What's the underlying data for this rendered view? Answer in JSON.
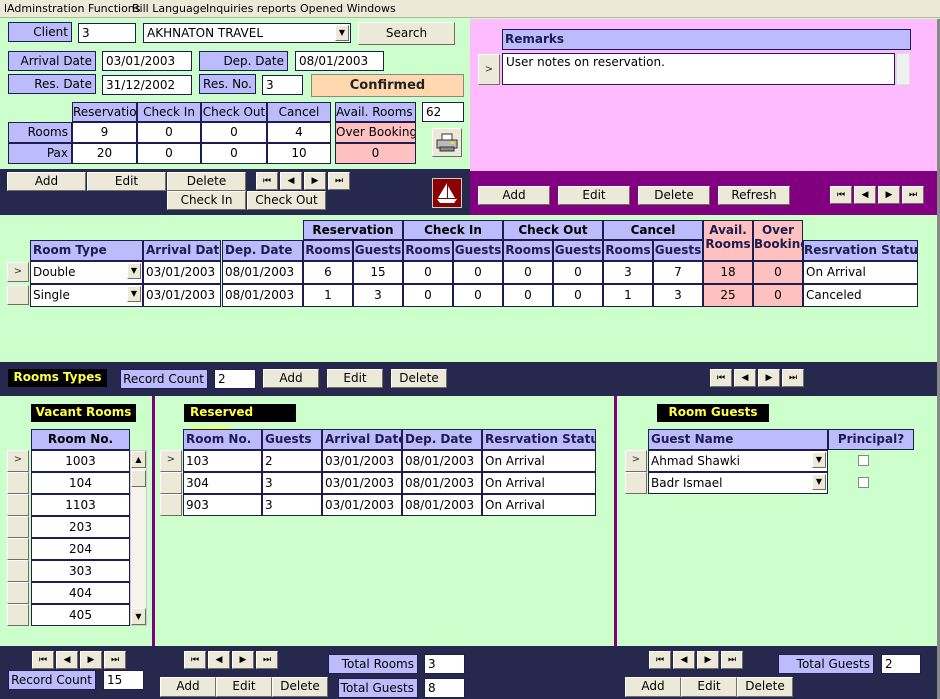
{
  "menu": [
    "lAdminstration Functions",
    "Bill Language",
    "Inquiries  reports",
    "Opened Windows"
  ],
  "header": {
    "client_label": "Client",
    "client_id": "3",
    "client_name": "AKHNATON TRAVEL",
    "search_label": "Search",
    "arrival_label": "Arrival Date",
    "arrival_value": "03/01/2003",
    "dep_label": "Dep. Date",
    "dep_value": "08/01/2003",
    "resdate_label": "Res. Date",
    "resdate_value": "31/12/2002",
    "resno_label": "Res. No.",
    "resno_value": "3",
    "status": "Confirmed"
  },
  "summary": {
    "columns": [
      "Reservation",
      "Check In",
      "Check Out",
      "Cancel"
    ],
    "rows": [
      {
        "label": "Rooms",
        "values": [
          "9",
          "0",
          "0",
          "4"
        ]
      },
      {
        "label": "Pax",
        "values": [
          "20",
          "0",
          "0",
          "10"
        ]
      }
    ],
    "avail_label": "Avail. Rooms",
    "avail_value": "62",
    "overbooking_label": "Over Booking",
    "overbooking_value": "0"
  },
  "main_toolbar": {
    "add": "Add",
    "edit": "Edit",
    "delete": "Delete",
    "checkin": "Check In",
    "checkout": "Check Out"
  },
  "remarks": {
    "title": "Remarks",
    "text": "User notes on reservation.",
    "add": "Add",
    "edit": "Edit",
    "delete": "Delete",
    "refresh": "Refresh"
  },
  "room_types": {
    "group_headers": [
      "Reservation",
      "Check In",
      "Check Out",
      "Cancel"
    ],
    "headers": [
      "Room Type",
      "Arrival Date",
      "Dep. Date",
      "Rooms",
      "Guests",
      "Rooms",
      "Guests",
      "Rooms",
      "Guests",
      "Rooms",
      "Guests",
      "Avail. Rooms",
      "Over Booking",
      "Resrvation Status"
    ],
    "rows": [
      [
        "Double",
        "03/01/2003",
        "08/01/2003",
        "6",
        "15",
        "0",
        "0",
        "0",
        "0",
        "3",
        "7",
        "18",
        "0",
        "On Arrival"
      ],
      [
        "Single",
        "03/01/2003",
        "08/01/2003",
        "1",
        "3",
        "0",
        "0",
        "0",
        "0",
        "1",
        "3",
        "25",
        "0",
        "Canceled"
      ]
    ]
  },
  "room_types_bar": {
    "title": "Rooms Types",
    "record_count_label": "Record Count",
    "record_count": "2",
    "add": "Add",
    "edit": "Edit",
    "delete": "Delete"
  },
  "vacant": {
    "title": "Vacant Rooms",
    "header": "Room No.",
    "rows": [
      "1003",
      "104",
      "1103",
      "203",
      "204",
      "303",
      "404",
      "405"
    ],
    "record_count_label": "Record Count",
    "record_count": "15"
  },
  "reserved": {
    "title": "Reserved rooms",
    "headers": [
      "Room No.",
      "Guests",
      "Arrival Date",
      "Dep. Date",
      "Resrvation Status"
    ],
    "rows": [
      [
        "103",
        "2",
        "03/01/2003",
        "08/01/2003",
        "On Arrival"
      ],
      [
        "304",
        "3",
        "03/01/2003",
        "08/01/2003",
        "On Arrival"
      ],
      [
        "903",
        "3",
        "03/01/2003",
        "08/01/2003",
        "On Arrival"
      ]
    ],
    "total_rooms_label": "Total Rooms",
    "total_rooms": "3",
    "total_guests_label": "Total Guests",
    "total_guests": "8",
    "add": "Add",
    "edit": "Edit",
    "delete": "Delete"
  },
  "guests": {
    "title": "Room Guests",
    "headers": [
      "Guest Name",
      "Principal?"
    ],
    "rows": [
      {
        "name": "Ahmad Shawki",
        "principal": false
      },
      {
        "name": "Badr Ismael",
        "principal": false
      }
    ],
    "total_guests_label": "Total Guests",
    "total_guests": "2",
    "add": "Add",
    "edit": "Edit",
    "delete": "Delete"
  },
  "icons": {
    "first": "⏮",
    "prev": "◀",
    "next": "▶",
    "last": "⏭",
    "dropdown": "▼",
    "record_selector": ">"
  }
}
